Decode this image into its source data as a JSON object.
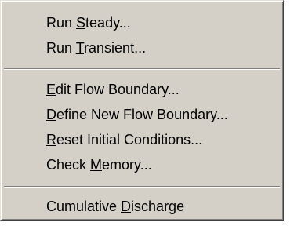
{
  "menu": {
    "groups": [
      {
        "items": [
          {
            "before": "Run ",
            "mnemonic": "S",
            "after": "teady..."
          },
          {
            "before": "Run ",
            "mnemonic": "T",
            "after": "ransient..."
          }
        ]
      },
      {
        "items": [
          {
            "before": "",
            "mnemonic": "E",
            "after": "dit Flow Boundary..."
          },
          {
            "before": "",
            "mnemonic": "D",
            "after": "efine New Flow Boundary..."
          },
          {
            "before": "",
            "mnemonic": "R",
            "after": "eset Initial Conditions..."
          },
          {
            "before": "Check ",
            "mnemonic": "M",
            "after": "emory..."
          }
        ]
      },
      {
        "items": [
          {
            "before": "Cumulative ",
            "mnemonic": "D",
            "after": "ischarge"
          }
        ]
      }
    ]
  }
}
